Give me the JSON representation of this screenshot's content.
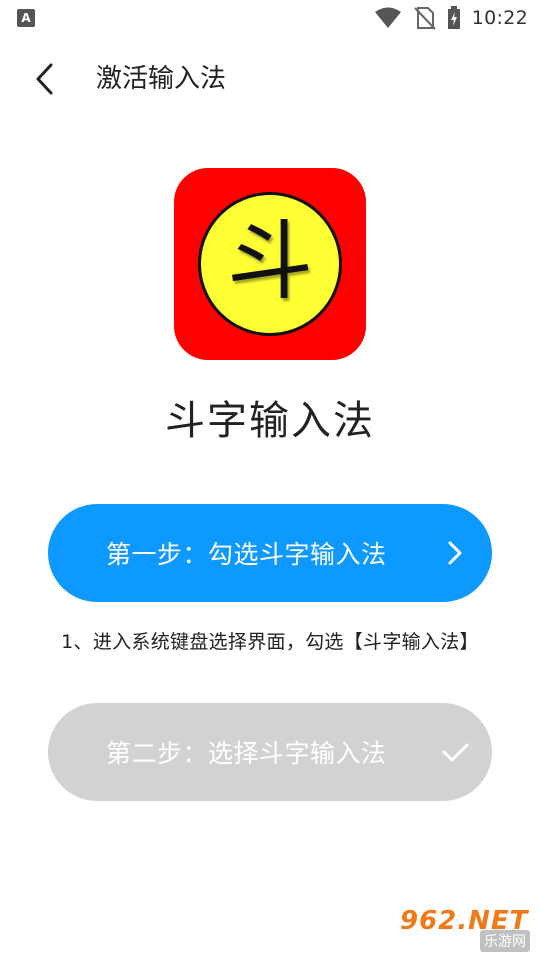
{
  "status_bar": {
    "left_icon_letter": "A",
    "time": "10:22",
    "icons": [
      "wifi-icon",
      "no-sim-icon",
      "battery-charging-icon"
    ]
  },
  "header": {
    "back_icon": "chevron-left-icon",
    "title": "激活输入法"
  },
  "app": {
    "icon_glyph": "斗",
    "name": "斗字输入法",
    "icon_colors": {
      "background": "#ff0000",
      "circle": "#ffff33"
    }
  },
  "steps": [
    {
      "label": "第一步：勾选斗字输入法",
      "icon": "chevron-right-icon",
      "state": "active",
      "color": "#0d99ff"
    },
    {
      "label": "第二步：选择斗字输入法",
      "icon": "check-icon",
      "state": "disabled",
      "color": "#d1d2d4"
    }
  ],
  "hint": "1、进入系统键盘选择界面，勾选【斗字输入法】",
  "watermark": {
    "main": "962.NET",
    "sub": "乐游网"
  }
}
